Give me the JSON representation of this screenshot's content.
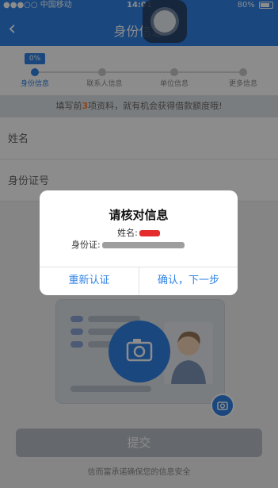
{
  "status_bar": {
    "carrier": "●●●○○ 中国移动",
    "time": "14:01",
    "battery": "80%"
  },
  "nav": {
    "title": "身份信息",
    "icons": {
      "back": "chevron-left-icon",
      "assistive": "assistive-touch-icon"
    }
  },
  "progress": {
    "percent_label": "0%",
    "steps": [
      "身份信息",
      "联系人信息",
      "单位信息",
      "更多信息"
    ],
    "active_index": 0
  },
  "notice": {
    "prefix": "填写前",
    "highlight": "3",
    "suffix": "项资料，就有机会获得借款额度哦!"
  },
  "form": {
    "name_label": "姓名",
    "id_label": "身份证号"
  },
  "upload": {
    "camera_icon": "camera-icon",
    "small_camera_icon": "camera-switch-icon"
  },
  "actions": {
    "submit": "提交"
  },
  "footer": {
    "text": "信而富承诺确保您的信息安全"
  },
  "dialog": {
    "title": "请核对信息",
    "name_label": "姓名:",
    "id_label": "身份证:",
    "left_button": "重新认证",
    "right_button": "确认，下一步"
  },
  "colors": {
    "primary": "#2f82e6",
    "accent": "#ff7b2f",
    "button_disabled": "#b9bec6"
  }
}
